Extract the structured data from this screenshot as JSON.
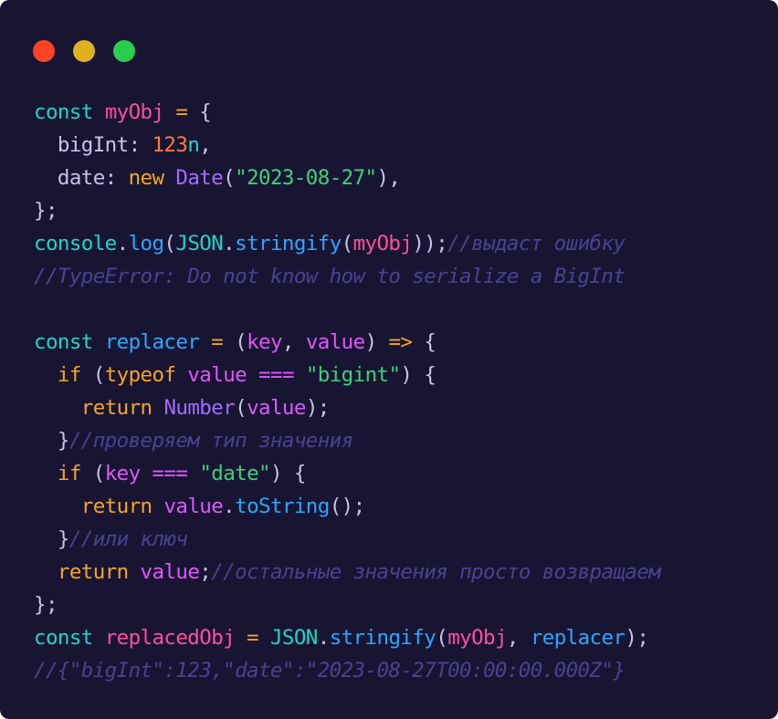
{
  "window": {
    "background": "#181533",
    "traffic_lights": [
      {
        "name": "close",
        "color": "#ff4423"
      },
      {
        "name": "minimize",
        "color": "#e0b01f"
      },
      {
        "name": "maximize",
        "color": "#28cf4c"
      }
    ]
  },
  "code": {
    "language": "javascript",
    "lines": [
      [
        {
          "t": "const",
          "c": "kw-const"
        },
        {
          "t": " ",
          "c": "punc"
        },
        {
          "t": "myObj",
          "c": "var-pink"
        },
        {
          "t": " ",
          "c": "punc"
        },
        {
          "t": "=",
          "c": "op"
        },
        {
          "t": " {",
          "c": "punc"
        }
      ],
      [
        {
          "t": "  bigInt: ",
          "c": "prop"
        },
        {
          "t": "123",
          "c": "num"
        },
        {
          "t": "n",
          "c": "kw-const"
        },
        {
          "t": ",",
          "c": "punc"
        }
      ],
      [
        {
          "t": "  date: ",
          "c": "prop"
        },
        {
          "t": "new",
          "c": "kw-y"
        },
        {
          "t": " ",
          "c": "punc"
        },
        {
          "t": "Date",
          "c": "cls"
        },
        {
          "t": "(",
          "c": "punc"
        },
        {
          "t": "\"2023-08-27\"",
          "c": "str"
        },
        {
          "t": "),",
          "c": "punc"
        }
      ],
      [
        {
          "t": "};",
          "c": "punc"
        }
      ],
      [
        {
          "t": "console",
          "c": "obj"
        },
        {
          "t": ".",
          "c": "punc"
        },
        {
          "t": "log",
          "c": "meth"
        },
        {
          "t": "(",
          "c": "punc"
        },
        {
          "t": "JSON",
          "c": "obj"
        },
        {
          "t": ".",
          "c": "punc"
        },
        {
          "t": "stringify",
          "c": "meth"
        },
        {
          "t": "(",
          "c": "punc"
        },
        {
          "t": "myObj",
          "c": "var-pink"
        },
        {
          "t": "));",
          "c": "punc"
        },
        {
          "t": "//выдаст ошибку",
          "c": "comment"
        }
      ],
      [
        {
          "t": "//TypeError: Do not know how to serialize a BigInt",
          "c": "comment"
        }
      ],
      [],
      [
        {
          "t": "const",
          "c": "kw-const"
        },
        {
          "t": " ",
          "c": "punc"
        },
        {
          "t": "replacer",
          "c": "meth"
        },
        {
          "t": " ",
          "c": "punc"
        },
        {
          "t": "=",
          "c": "op"
        },
        {
          "t": " (",
          "c": "punc"
        },
        {
          "t": "key",
          "c": "param"
        },
        {
          "t": ", ",
          "c": "punc"
        },
        {
          "t": "value",
          "c": "param"
        },
        {
          "t": ") ",
          "c": "punc"
        },
        {
          "t": "=>",
          "c": "op"
        },
        {
          "t": " {",
          "c": "punc"
        }
      ],
      [
        {
          "t": "  ",
          "c": "punc"
        },
        {
          "t": "if",
          "c": "kw-y"
        },
        {
          "t": " (",
          "c": "punc"
        },
        {
          "t": "typeof",
          "c": "kw-y"
        },
        {
          "t": " ",
          "c": "punc"
        },
        {
          "t": "value",
          "c": "param"
        },
        {
          "t": " ",
          "c": "punc"
        },
        {
          "t": "===",
          "c": "param"
        },
        {
          "t": " ",
          "c": "punc"
        },
        {
          "t": "\"bigint\"",
          "c": "str"
        },
        {
          "t": ") {",
          "c": "punc"
        }
      ],
      [
        {
          "t": "    ",
          "c": "punc"
        },
        {
          "t": "return",
          "c": "kw-y"
        },
        {
          "t": " ",
          "c": "punc"
        },
        {
          "t": "Number",
          "c": "cls"
        },
        {
          "t": "(",
          "c": "punc"
        },
        {
          "t": "value",
          "c": "param"
        },
        {
          "t": ");",
          "c": "punc"
        }
      ],
      [
        {
          "t": "  }",
          "c": "punc"
        },
        {
          "t": "//проверяем тип значения",
          "c": "comment"
        }
      ],
      [
        {
          "t": "  ",
          "c": "punc"
        },
        {
          "t": "if",
          "c": "kw-y"
        },
        {
          "t": " (",
          "c": "punc"
        },
        {
          "t": "key",
          "c": "param"
        },
        {
          "t": " ",
          "c": "punc"
        },
        {
          "t": "===",
          "c": "param"
        },
        {
          "t": " ",
          "c": "punc"
        },
        {
          "t": "\"date\"",
          "c": "str"
        },
        {
          "t": ") {",
          "c": "punc"
        }
      ],
      [
        {
          "t": "    ",
          "c": "punc"
        },
        {
          "t": "return",
          "c": "kw-y"
        },
        {
          "t": " ",
          "c": "punc"
        },
        {
          "t": "value",
          "c": "param"
        },
        {
          "t": ".",
          "c": "punc"
        },
        {
          "t": "toString",
          "c": "meth"
        },
        {
          "t": "();",
          "c": "punc"
        }
      ],
      [
        {
          "t": "  }",
          "c": "punc"
        },
        {
          "t": "//или ключ",
          "c": "comment"
        }
      ],
      [
        {
          "t": "  ",
          "c": "punc"
        },
        {
          "t": "return",
          "c": "kw-y"
        },
        {
          "t": " ",
          "c": "punc"
        },
        {
          "t": "value",
          "c": "param"
        },
        {
          "t": ";",
          "c": "punc"
        },
        {
          "t": "//остальные значения просто возвращаем",
          "c": "comment"
        }
      ],
      [
        {
          "t": "};",
          "c": "punc"
        }
      ],
      [
        {
          "t": "const",
          "c": "kw-const"
        },
        {
          "t": " ",
          "c": "punc"
        },
        {
          "t": "replacedObj",
          "c": "var-pink"
        },
        {
          "t": " ",
          "c": "punc"
        },
        {
          "t": "=",
          "c": "op"
        },
        {
          "t": " ",
          "c": "punc"
        },
        {
          "t": "JSON",
          "c": "obj"
        },
        {
          "t": ".",
          "c": "punc"
        },
        {
          "t": "stringify",
          "c": "meth"
        },
        {
          "t": "(",
          "c": "punc"
        },
        {
          "t": "myObj",
          "c": "var-pink"
        },
        {
          "t": ", ",
          "c": "punc"
        },
        {
          "t": "replacer",
          "c": "meth"
        },
        {
          "t": ");",
          "c": "punc"
        }
      ],
      [
        {
          "t": "//{\"bigInt\":123,\"date\":\"2023-08-27T00:00:00.000Z\"}",
          "c": "comment"
        }
      ]
    ]
  }
}
